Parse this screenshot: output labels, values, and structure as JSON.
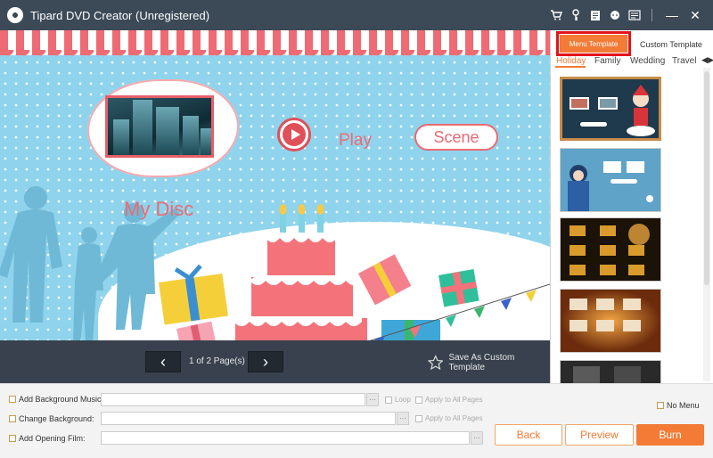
{
  "window": {
    "title": "Tipard DVD Creator (Unregistered)",
    "toolbar_icons": [
      "cart-icon",
      "key-icon",
      "document-icon",
      "chat-icon",
      "menu-icon"
    ],
    "controls": {
      "minimize": "—",
      "close": "✕"
    }
  },
  "preview": {
    "disc_title": "My Disc",
    "play_label": "Play",
    "scene_label": "Scene",
    "pagination": {
      "prev": "‹",
      "next": "›",
      "text": "1 of 2 Page(s)"
    },
    "save_custom_label": "Save As Custom Template"
  },
  "template_panel": {
    "tabs": [
      {
        "label": "Menu Template",
        "active": true
      },
      {
        "label": "Custom Template",
        "active": false
      }
    ],
    "categories": [
      {
        "label": "Holiday",
        "active": true
      },
      {
        "label": "Family",
        "active": false
      },
      {
        "label": "Wedding",
        "active": false
      },
      {
        "label": "Travel",
        "active": false
      }
    ],
    "category_arrows": "◀▶",
    "templates": [
      {
        "id": "christmas-santa",
        "selected": true
      },
      {
        "id": "winter-child",
        "selected": false
      },
      {
        "id": "halloween-pumpkin",
        "selected": false
      },
      {
        "id": "autumn-gold",
        "selected": false
      },
      {
        "id": "dark-partial",
        "selected": false
      }
    ]
  },
  "options": {
    "background_music": {
      "label": "Add Background Music:",
      "value": "",
      "loop_label": "Loop",
      "apply_label": "Apply to All Pages"
    },
    "change_background": {
      "label": "Change Background:",
      "value": "",
      "apply_label": "Apply to All Pages"
    },
    "opening_film": {
      "label": "Add Opening Film:",
      "value": ""
    },
    "browse_label": "···",
    "no_menu_label": "No Menu"
  },
  "actions": {
    "back": "Back",
    "preview": "Preview",
    "burn": "Burn"
  },
  "colors": {
    "accent": "#f37b36",
    "titlebar": "#3c4956",
    "highlight_box": "#e4131b",
    "theme_red": "#ec6a72"
  }
}
